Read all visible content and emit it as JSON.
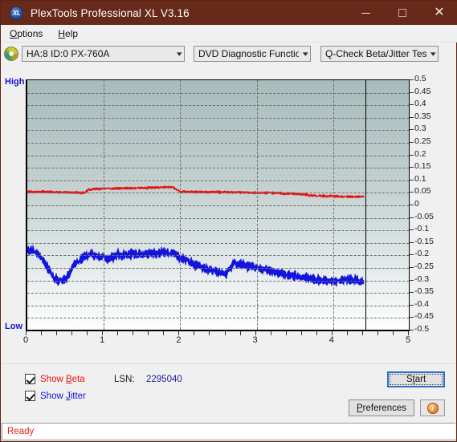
{
  "window": {
    "title": "PlexTools Professional XL V3.16",
    "app_icon": "xl-logo-icon",
    "icon_text": "XL",
    "titlebar_color": "#66291a",
    "controls": {
      "minimize": "minimize-icon",
      "maximize": "maximize-icon",
      "close": "close-icon"
    }
  },
  "menubar": {
    "items": [
      {
        "label": "Options",
        "accel": "O"
      },
      {
        "label": "Help",
        "accel": "H"
      }
    ]
  },
  "toolbar": {
    "disc_icon": "optical-disc-icon",
    "drive_select": {
      "value": "HA:8 ID:0  PX-760A",
      "options": [
        "HA:8 ID:0  PX-760A"
      ]
    },
    "function_select": {
      "value": "DVD Diagnostic Functions",
      "options": [
        "DVD Diagnostic Functions"
      ]
    },
    "test_select": {
      "value": "Q-Check Beta/Jitter Test",
      "options": [
        "Q-Check Beta/Jitter Test"
      ]
    }
  },
  "chart_data": {
    "type": "line",
    "title": "",
    "xlabel": "",
    "ylabel": "",
    "axis_left_top_label": "High",
    "axis_left_bottom_label": "Low",
    "xlim": [
      0,
      5
    ],
    "ylim": [
      -0.5,
      0.5
    ],
    "x_ticks": [
      "0",
      "1",
      "2",
      "3",
      "4",
      "5"
    ],
    "x_tick_values": [
      0,
      1,
      2,
      3,
      4,
      5
    ],
    "y_ticks": [
      "0.5",
      "0.45",
      "0.4",
      "0.35",
      "0.3",
      "0.25",
      "0.2",
      "0.15",
      "0.1",
      "0.05",
      "0",
      "-0.05",
      "-0.1",
      "-0.15",
      "-0.2",
      "-0.25",
      "-0.3",
      "-0.35",
      "-0.4",
      "-0.45",
      "-0.5"
    ],
    "y_tick_values": [
      0.5,
      0.45,
      0.4,
      0.35,
      0.3,
      0.25,
      0.2,
      0.15,
      0.1,
      0.05,
      0,
      -0.05,
      -0.1,
      -0.15,
      -0.2,
      -0.25,
      -0.3,
      -0.35,
      -0.4,
      -0.45,
      -0.5
    ],
    "grid": true,
    "grid_style": "dashed",
    "legend": "none",
    "data_end_x": 4.4,
    "series": [
      {
        "name": "Beta",
        "color": "#e81414",
        "x": [
          0.0,
          0.1,
          0.2,
          0.3,
          0.4,
          0.5,
          0.6,
          0.7,
          0.75,
          0.8,
          0.9,
          1.0,
          1.1,
          1.2,
          1.3,
          1.4,
          1.5,
          1.6,
          1.7,
          1.8,
          1.9,
          2.0,
          2.1,
          2.2,
          2.3,
          2.4,
          2.5,
          2.6,
          2.7,
          2.8,
          2.9,
          3.0,
          3.1,
          3.2,
          3.3,
          3.4,
          3.5,
          3.6,
          3.7,
          3.8,
          3.9,
          4.0,
          4.1,
          4.2,
          4.3,
          4.4
        ],
        "values": [
          0.055,
          0.053,
          0.054,
          0.053,
          0.052,
          0.052,
          0.051,
          0.05,
          0.05,
          0.062,
          0.066,
          0.068,
          0.067,
          0.068,
          0.069,
          0.069,
          0.07,
          0.07,
          0.071,
          0.072,
          0.072,
          0.055,
          0.054,
          0.054,
          0.054,
          0.053,
          0.053,
          0.053,
          0.052,
          0.052,
          0.051,
          0.05,
          0.05,
          0.049,
          0.048,
          0.047,
          0.046,
          0.044,
          0.04,
          0.038,
          0.037,
          0.036,
          0.035,
          0.035,
          0.034,
          0.034
        ],
        "noise": 0.006
      },
      {
        "name": "Jitter",
        "color": "#1414e0",
        "x": [
          0.0,
          0.05,
          0.1,
          0.15,
          0.2,
          0.25,
          0.3,
          0.35,
          0.4,
          0.45,
          0.5,
          0.55,
          0.6,
          0.65,
          0.7,
          0.75,
          0.8,
          0.85,
          0.9,
          0.95,
          1.0,
          1.05,
          1.1,
          1.2,
          1.3,
          1.4,
          1.5,
          1.6,
          1.7,
          1.8,
          1.9,
          1.95,
          2.0,
          2.1,
          2.2,
          2.3,
          2.4,
          2.5,
          2.6,
          2.7,
          2.8,
          2.9,
          3.0,
          3.1,
          3.2,
          3.3,
          3.4,
          3.5,
          3.6,
          3.7,
          3.8,
          3.9,
          4.0,
          4.1,
          4.2,
          4.3,
          4.4
        ],
        "values": [
          -0.18,
          -0.178,
          -0.185,
          -0.2,
          -0.218,
          -0.24,
          -0.265,
          -0.288,
          -0.3,
          -0.302,
          -0.296,
          -0.272,
          -0.245,
          -0.225,
          -0.212,
          -0.205,
          -0.2,
          -0.2,
          -0.203,
          -0.206,
          -0.208,
          -0.218,
          -0.205,
          -0.198,
          -0.196,
          -0.194,
          -0.196,
          -0.192,
          -0.19,
          -0.188,
          -0.19,
          -0.196,
          -0.212,
          -0.222,
          -0.238,
          -0.25,
          -0.258,
          -0.266,
          -0.272,
          -0.23,
          -0.236,
          -0.242,
          -0.25,
          -0.258,
          -0.264,
          -0.272,
          -0.278,
          -0.284,
          -0.288,
          -0.292,
          -0.296,
          -0.3,
          -0.302,
          -0.3,
          -0.296,
          -0.3,
          -0.308
        ],
        "noise": 0.022
      }
    ]
  },
  "controls": {
    "show_beta": {
      "label_pre": "Show ",
      "label_accel": "B",
      "label_post": "eta",
      "checked": true,
      "color": "#e81414"
    },
    "show_jitter": {
      "label_pre": "Show ",
      "label_accel": "J",
      "label_post": "itter",
      "checked": true,
      "color": "#1414e0"
    },
    "lsn_label": "LSN:",
    "lsn_value": "2295040",
    "start_button": {
      "pre": "S",
      "accel": "t",
      "post": "art",
      "label": "Start"
    },
    "preferences_button": {
      "pre": "",
      "accel": "P",
      "post": "references",
      "label": "Preferences"
    },
    "info_button": {
      "icon": "info-icon",
      "glyph": "i"
    }
  },
  "statusbar": {
    "text": "Ready",
    "color": "#e02020"
  }
}
